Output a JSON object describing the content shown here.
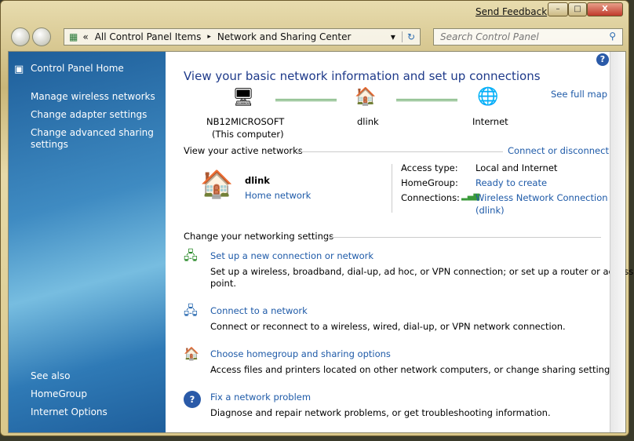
{
  "window": {
    "send_feedback": "Send Feedback",
    "min": "–",
    "max": "□",
    "close": "X"
  },
  "address": {
    "back_chevron": "«",
    "crumbs": [
      "All Control Panel Items",
      "Network and Sharing Center"
    ],
    "sep": "▸",
    "dropdown": "▾",
    "refresh": "↻"
  },
  "search": {
    "placeholder": "Search Control Panel",
    "icon": "⚲"
  },
  "sidebar": {
    "home": "Control Panel Home",
    "items": [
      "Manage wireless networks",
      "Change adapter settings",
      "Change advanced sharing settings"
    ],
    "see_also": "See also",
    "see_also_items": [
      "HomeGroup",
      "Internet Options"
    ]
  },
  "main": {
    "title": "View your basic network information and set up connections",
    "see_full_map": "See full map",
    "map": {
      "computer": "NB12MICROSOFT",
      "computer_sub": "(This computer)",
      "router": "dlink",
      "internet": "Internet"
    },
    "active_heading": "View your active networks",
    "connect_disconnect": "Connect or disconnect",
    "network": {
      "name": "dlink",
      "type": "Home network",
      "access_label": "Access type:",
      "access_value": "Local and Internet",
      "homegroup_label": "HomeGroup:",
      "homegroup_value": "Ready to create",
      "connections_label": "Connections:",
      "connections_value": "Wireless Network Connection",
      "connections_value2": "(dlink)"
    },
    "settings_heading": "Change your networking settings",
    "tasks": [
      {
        "title": "Set up a new connection or network",
        "desc": "Set up a wireless, broadband, dial-up, ad hoc, or VPN connection; or set up a router or access",
        "desc2": "point."
      },
      {
        "title": "Connect to a network",
        "desc": "Connect or reconnect to a wireless, wired, dial-up, or VPN network connection."
      },
      {
        "title": "Choose homegroup and sharing options",
        "desc": "Access files and printers located on other network computers, or change sharing settings."
      },
      {
        "title": "Fix a network problem",
        "desc": "Diagnose and repair network problems, or get troubleshooting information."
      }
    ],
    "help": "?"
  },
  "colors": {
    "link": "#1e5aa8",
    "title": "#1e3a8a",
    "sidebar": "#2f7ab6"
  }
}
